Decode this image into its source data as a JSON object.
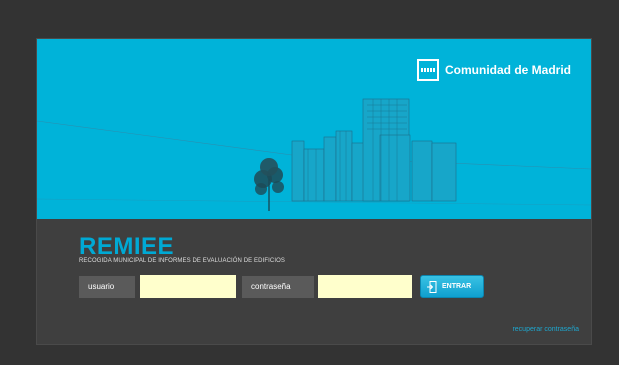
{
  "brand": {
    "name": "Comunidad de Madrid",
    "logo_icon": "madrid-stars-logo-icon"
  },
  "app": {
    "title": "REMIEE",
    "subtitle": "RECOGIDA MUNICIPAL DE INFORMES DE EVALUACIÓN DE EDIFICIOS"
  },
  "login": {
    "user_label": "usuario",
    "user_value": "",
    "password_label": "contraseña",
    "password_value": "",
    "submit_label": "ENTRAR",
    "submit_icon": "enter-door-icon",
    "recover_link": "recuperar contraseña"
  },
  "colors": {
    "page_bg": "#333333",
    "hero_bg": "#00b3d9",
    "panel_bg": "#3f3f3f",
    "accent": "#1ea7cf",
    "input_bg": "#ffffcc"
  }
}
